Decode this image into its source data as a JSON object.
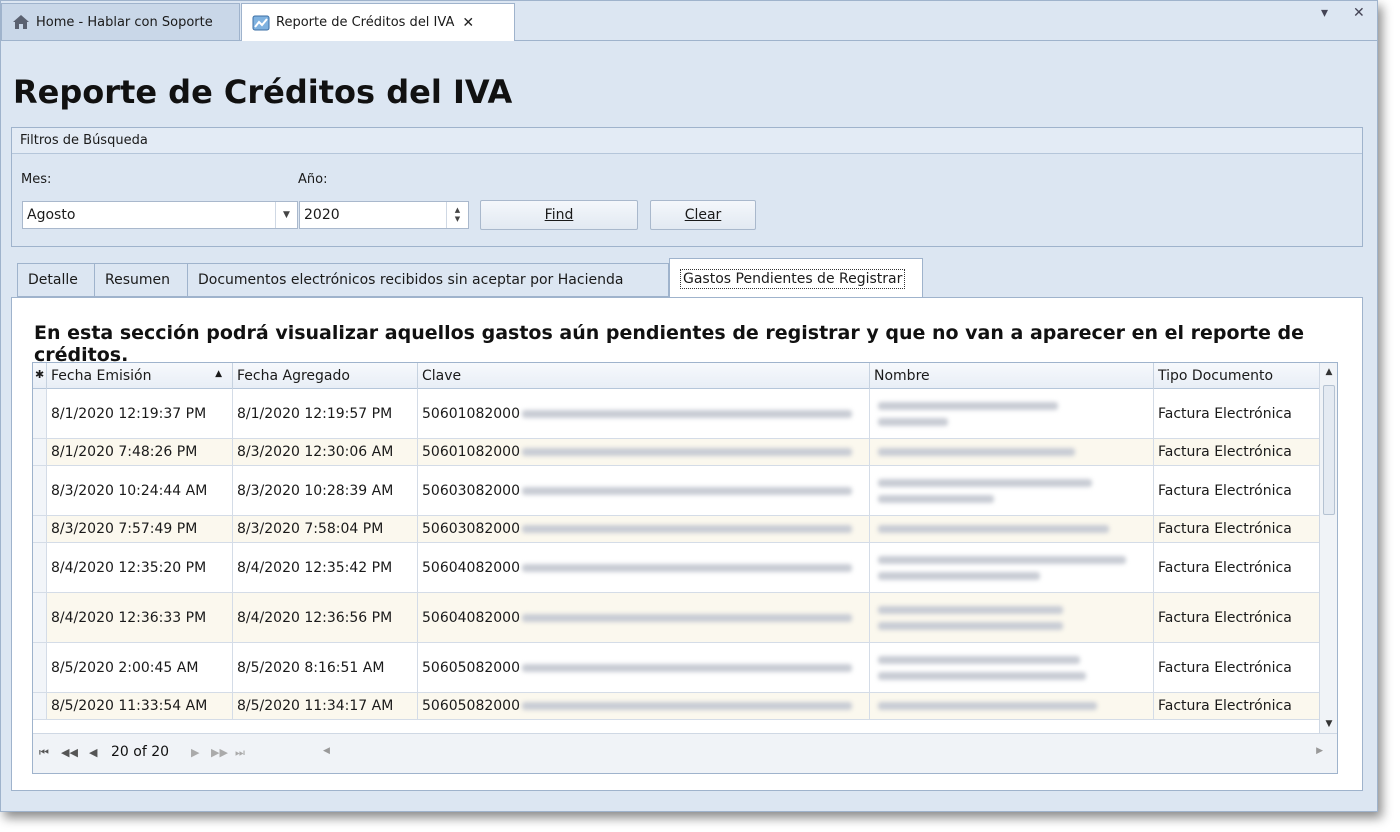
{
  "doc_tabs": [
    {
      "label": "Home - Hablar con Soporte",
      "icon": "home-icon"
    },
    {
      "label": "Reporte de Créditos del IVA",
      "icon": "report-icon"
    }
  ],
  "window_controls": {
    "menu": "▾",
    "close": "✕"
  },
  "page_title": "Reporte de Créditos del IVA",
  "filters": {
    "group_title": "Filtros de Búsqueda",
    "month_label": "Mes:",
    "month_value": "Agosto",
    "year_label": "Año:",
    "year_value": "2020",
    "find_label": "Find",
    "clear_label": "Clear"
  },
  "section_tabs": [
    "Detalle",
    "Resumen",
    "Documentos electrónicos recibidos sin aceptar por Hacienda",
    "Gastos Pendientes de Registrar"
  ],
  "description": "En esta sección podrá visualizar aquellos gastos aún pendientes de registrar y que no van a aparecer en el reporte de créditos.",
  "grid": {
    "columns": [
      "Fecha Emisión",
      "Fecha Agregado",
      "Clave",
      "Nombre",
      "Tipo Documento"
    ],
    "rows": [
      {
        "fecha_emision": "8/1/2020 12:19:37 PM",
        "fecha_agregado": "8/1/2020 12:19:57 PM",
        "clave": "50601082000",
        "tipo": "Factura Electrónica"
      },
      {
        "fecha_emision": "8/1/2020 7:48:26 PM",
        "fecha_agregado": "8/3/2020 12:30:06 AM",
        "clave": "50601082000",
        "tipo": "Factura Electrónica"
      },
      {
        "fecha_emision": "8/3/2020 10:24:44 AM",
        "fecha_agregado": "8/3/2020 10:28:39 AM",
        "clave": "50603082000",
        "tipo": "Factura Electrónica"
      },
      {
        "fecha_emision": "8/3/2020 7:57:49 PM",
        "fecha_agregado": "8/3/2020 7:58:04 PM",
        "clave": "50603082000",
        "tipo": "Factura Electrónica"
      },
      {
        "fecha_emision": "8/4/2020 12:35:20 PM",
        "fecha_agregado": "8/4/2020 12:35:42 PM",
        "clave": "50604082000",
        "tipo": "Factura Electrónica"
      },
      {
        "fecha_emision": "8/4/2020 12:36:33 PM",
        "fecha_agregado": "8/4/2020 12:36:56 PM",
        "clave": "50604082000",
        "tipo": "Factura Electrónica"
      },
      {
        "fecha_emision": "8/5/2020 2:00:45 AM",
        "fecha_agregado": "8/5/2020 8:16:51 AM",
        "clave": "50605082000",
        "tipo": "Factura Electrónica"
      },
      {
        "fecha_emision": "8/5/2020 11:33:54 AM",
        "fecha_agregado": "8/5/2020 11:34:17 AM",
        "clave": "50605082000",
        "tipo": "Factura Electrónica"
      }
    ],
    "pager": "20 of 20"
  }
}
